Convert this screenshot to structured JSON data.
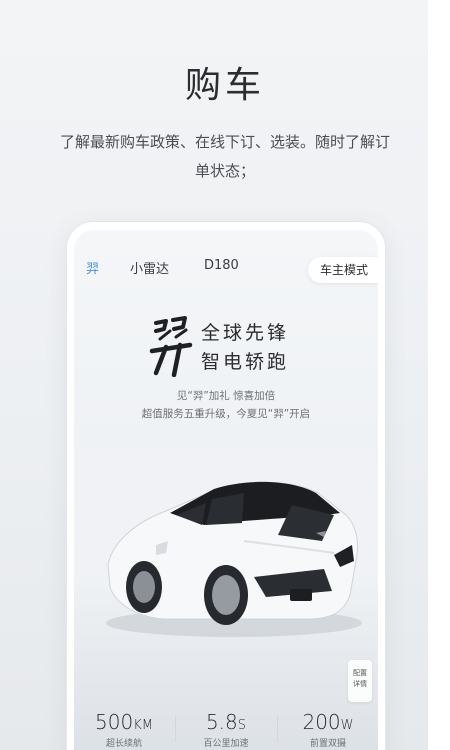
{
  "page": {
    "headline": "购车",
    "subtext": "了解最新购车政策、在线下订、选装。随时了解订单状态；"
  },
  "phone": {
    "tabs": [
      {
        "label": "羿",
        "active": true
      },
      {
        "label": "小雷达",
        "active": false
      },
      {
        "label": "D180",
        "active": false
      }
    ],
    "owner_mode": "车主模式",
    "brand_mark": "羿",
    "slogan_line1": "全球先锋",
    "slogan_line2": "智电轿跑",
    "promo_line1": "见“羿”加礼 惊喜加倍",
    "promo_line2": "超值服务五重升级，今夏见“羿”开启",
    "config_line1": "配置",
    "config_line2": "详情",
    "stats": [
      {
        "value": "500",
        "unit": "KM",
        "label": "超长续航"
      },
      {
        "value": "5.8",
        "unit": "S",
        "label": "百公里加速"
      },
      {
        "value": "200",
        "unit": "W",
        "label": "前置双摄"
      }
    ]
  },
  "colors": {
    "accent": "#4a8de0",
    "text": "#2b2d30"
  },
  "icons": [
    "car-image",
    "config-icon"
  ]
}
